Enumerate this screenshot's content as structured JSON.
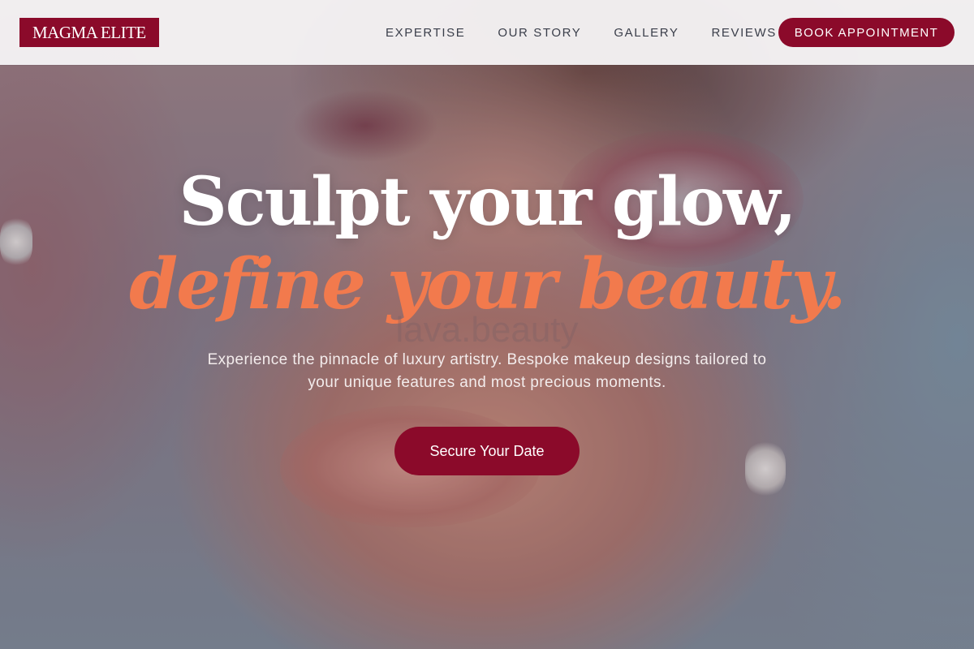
{
  "brand": {
    "logo_text": "MAGMA ELITE",
    "color": "#8b0a2a"
  },
  "nav": {
    "items": [
      {
        "label": "EXPERTISE"
      },
      {
        "label": "OUR STORY"
      },
      {
        "label": "GALLERY"
      },
      {
        "label": "REVIEWS"
      }
    ],
    "book_label": "BOOK APPOINTMENT"
  },
  "hero": {
    "headline_line1": "Sculpt your glow,",
    "headline_line2": "define your beauty.",
    "headline_accent_color": "#f27a4d",
    "watermark": "lava.beauty",
    "subtext": "Experience the pinnacle of luxury artistry. Bespoke makeup designs tailored to your unique features and most precious moments.",
    "cta_label": "Secure Your Date"
  }
}
